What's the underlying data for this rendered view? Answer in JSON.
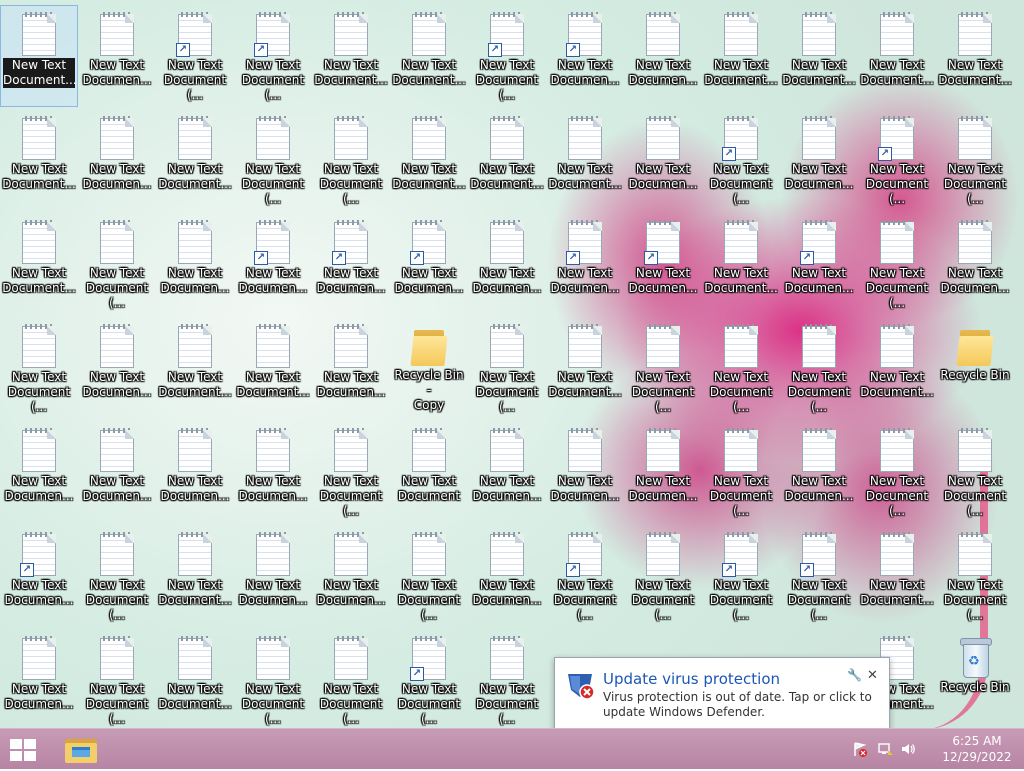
{
  "desktop": {
    "columns": 13,
    "rows": 7,
    "icons": [
      {
        "label": "New Text\nDocument...",
        "type": "doc",
        "selected": true
      },
      {
        "label": "New Text\nDocumen...",
        "type": "doc"
      },
      {
        "label": "New Text\nDocument (...",
        "type": "doc",
        "shortcut": true
      },
      {
        "label": "New Text\nDocument (...",
        "type": "doc",
        "shortcut": true
      },
      {
        "label": "New Text\nDocument...",
        "type": "doc"
      },
      {
        "label": "New Text\nDocument...",
        "type": "doc"
      },
      {
        "label": "New Text\nDocument (...",
        "type": "doc",
        "shortcut": true
      },
      {
        "label": "New Text\nDocumen...",
        "type": "doc",
        "shortcut": true
      },
      {
        "label": "New Text\nDocumen...",
        "type": "doc"
      },
      {
        "label": "New Text\nDocument...",
        "type": "doc"
      },
      {
        "label": "New Text\nDocument...",
        "type": "doc"
      },
      {
        "label": "New Text\nDocument...",
        "type": "doc"
      },
      {
        "label": "New Text\nDocument...",
        "type": "doc"
      },
      {
        "label": "New Text\nDocument...",
        "type": "doc"
      },
      {
        "label": "New Text\nDocumen...",
        "type": "doc"
      },
      {
        "label": "New Text\nDocument...",
        "type": "doc"
      },
      {
        "label": "New Text\nDocument (...",
        "type": "doc"
      },
      {
        "label": "New Text\nDocument (...",
        "type": "doc"
      },
      {
        "label": "New Text\nDocument...",
        "type": "doc"
      },
      {
        "label": "New Text\nDocument...",
        "type": "doc"
      },
      {
        "label": "New Text\nDocument...",
        "type": "doc"
      },
      {
        "label": "New Text\nDocumen...",
        "type": "doc"
      },
      {
        "label": "New Text\nDocument (...",
        "type": "doc",
        "shortcut": true
      },
      {
        "label": "New Text\nDocumen...",
        "type": "doc"
      },
      {
        "label": "New Text\nDocument (...",
        "type": "doc",
        "shortcut": true
      },
      {
        "label": "New Text\nDocument (...",
        "type": "doc"
      },
      {
        "label": "New Text\nDocument...",
        "type": "doc"
      },
      {
        "label": "New Text\nDocument (...",
        "type": "doc"
      },
      {
        "label": "New Text\nDocumen...",
        "type": "doc"
      },
      {
        "label": "New Text\nDocumen...",
        "type": "doc",
        "shortcut": true
      },
      {
        "label": "New Text\nDocumen...",
        "type": "doc",
        "shortcut": true
      },
      {
        "label": "New Text\nDocumen...",
        "type": "doc",
        "shortcut": true
      },
      {
        "label": "New Text\nDocumen...",
        "type": "doc"
      },
      {
        "label": "New Text\nDocumen...",
        "type": "doc",
        "shortcut": true
      },
      {
        "label": "New Text\nDocumen...",
        "type": "doc",
        "shortcut": true
      },
      {
        "label": "New Text\nDocument...",
        "type": "doc"
      },
      {
        "label": "New Text\nDocumen...",
        "type": "doc",
        "shortcut": true
      },
      {
        "label": "New Text\nDocument (...",
        "type": "doc"
      },
      {
        "label": "New Text\nDocumen...",
        "type": "doc"
      },
      {
        "label": "New Text\nDocument (...",
        "type": "doc"
      },
      {
        "label": "New Text\nDocumen...",
        "type": "doc"
      },
      {
        "label": "New Text\nDocument...",
        "type": "doc"
      },
      {
        "label": "New Text\nDocument...",
        "type": "doc"
      },
      {
        "label": "New Text\nDocumen...",
        "type": "doc"
      },
      {
        "label": "Recycle Bin -\nCopy",
        "type": "folder"
      },
      {
        "label": "New Text\nDocument (...",
        "type": "doc"
      },
      {
        "label": "New Text\nDocument...",
        "type": "doc"
      },
      {
        "label": "New Text\nDocument (...",
        "type": "doc"
      },
      {
        "label": "New Text\nDocument (...",
        "type": "doc"
      },
      {
        "label": "New Text\nDocument (...",
        "type": "doc"
      },
      {
        "label": "New Text\nDocument...",
        "type": "doc"
      },
      {
        "label": "Recycle Bin",
        "type": "folder"
      },
      {
        "label": "New Text\nDocumen...",
        "type": "doc"
      },
      {
        "label": "New Text\nDocumen...",
        "type": "doc"
      },
      {
        "label": "New Text\nDocumen...",
        "type": "doc"
      },
      {
        "label": "New Text\nDocumen...",
        "type": "doc"
      },
      {
        "label": "New Text\nDocument (...",
        "type": "doc"
      },
      {
        "label": "New Text\nDocument",
        "type": "doc"
      },
      {
        "label": "New Text\nDocumen...",
        "type": "doc"
      },
      {
        "label": "New Text\nDocumen...",
        "type": "doc"
      },
      {
        "label": "New Text\nDocumen...",
        "type": "doc"
      },
      {
        "label": "New Text\nDocument (...",
        "type": "doc"
      },
      {
        "label": "New Text\nDocumen...",
        "type": "doc"
      },
      {
        "label": "New Text\nDocument (...",
        "type": "doc"
      },
      {
        "label": "New Text\nDocument (...",
        "type": "doc"
      },
      {
        "label": "New Text\nDocumen...",
        "type": "doc",
        "shortcut": true
      },
      {
        "label": "New Text\nDocument (...",
        "type": "doc"
      },
      {
        "label": "New Text\nDocument...",
        "type": "doc"
      },
      {
        "label": "New Text\nDocumen...",
        "type": "doc"
      },
      {
        "label": "New Text\nDocumen...",
        "type": "doc"
      },
      {
        "label": "New Text\nDocument (...",
        "type": "doc"
      },
      {
        "label": "New Text\nDocumen...",
        "type": "doc"
      },
      {
        "label": "New Text\nDocument (...",
        "type": "doc",
        "shortcut": true
      },
      {
        "label": "New Text\nDocument (...",
        "type": "doc"
      },
      {
        "label": "New Text\nDocument (...",
        "type": "doc",
        "shortcut": true
      },
      {
        "label": "New Text\nDocument (...",
        "type": "doc",
        "shortcut": true
      },
      {
        "label": "New Text\nDocument...",
        "type": "doc"
      },
      {
        "label": "New Text\nDocument (...",
        "type": "doc"
      },
      {
        "label": "New Text\nDocumen...",
        "type": "doc"
      },
      {
        "label": "New Text\nDocument (...",
        "type": "doc"
      },
      {
        "label": "New Text\nDocument...",
        "type": "doc"
      },
      {
        "label": "New Text\nDocument (...",
        "type": "doc"
      },
      {
        "label": "New Text\nDocument (...",
        "type": "doc"
      },
      {
        "label": "New Text\nDocument (...",
        "type": "doc",
        "shortcut": true
      },
      {
        "label": "New Text\nDocument (...",
        "type": "doc"
      },
      {
        "label": "",
        "type": "hidden"
      },
      {
        "label": "",
        "type": "hidden"
      },
      {
        "label": "",
        "type": "hidden"
      },
      {
        "label": "",
        "type": "hidden"
      },
      {
        "label": "New Text\nDocument...",
        "type": "doc"
      },
      {
        "label": "Recycle Bin",
        "type": "bin"
      }
    ]
  },
  "toast": {
    "title": "Update virus protection",
    "body": "Virus protection is out of date. Tap or click to update Windows Defender."
  },
  "taskbar": {
    "time": "6:25 AM",
    "date": "12/29/2022"
  },
  "colors": {
    "toast_title": "#1b57b5",
    "taskbar": "#bf8fae"
  }
}
